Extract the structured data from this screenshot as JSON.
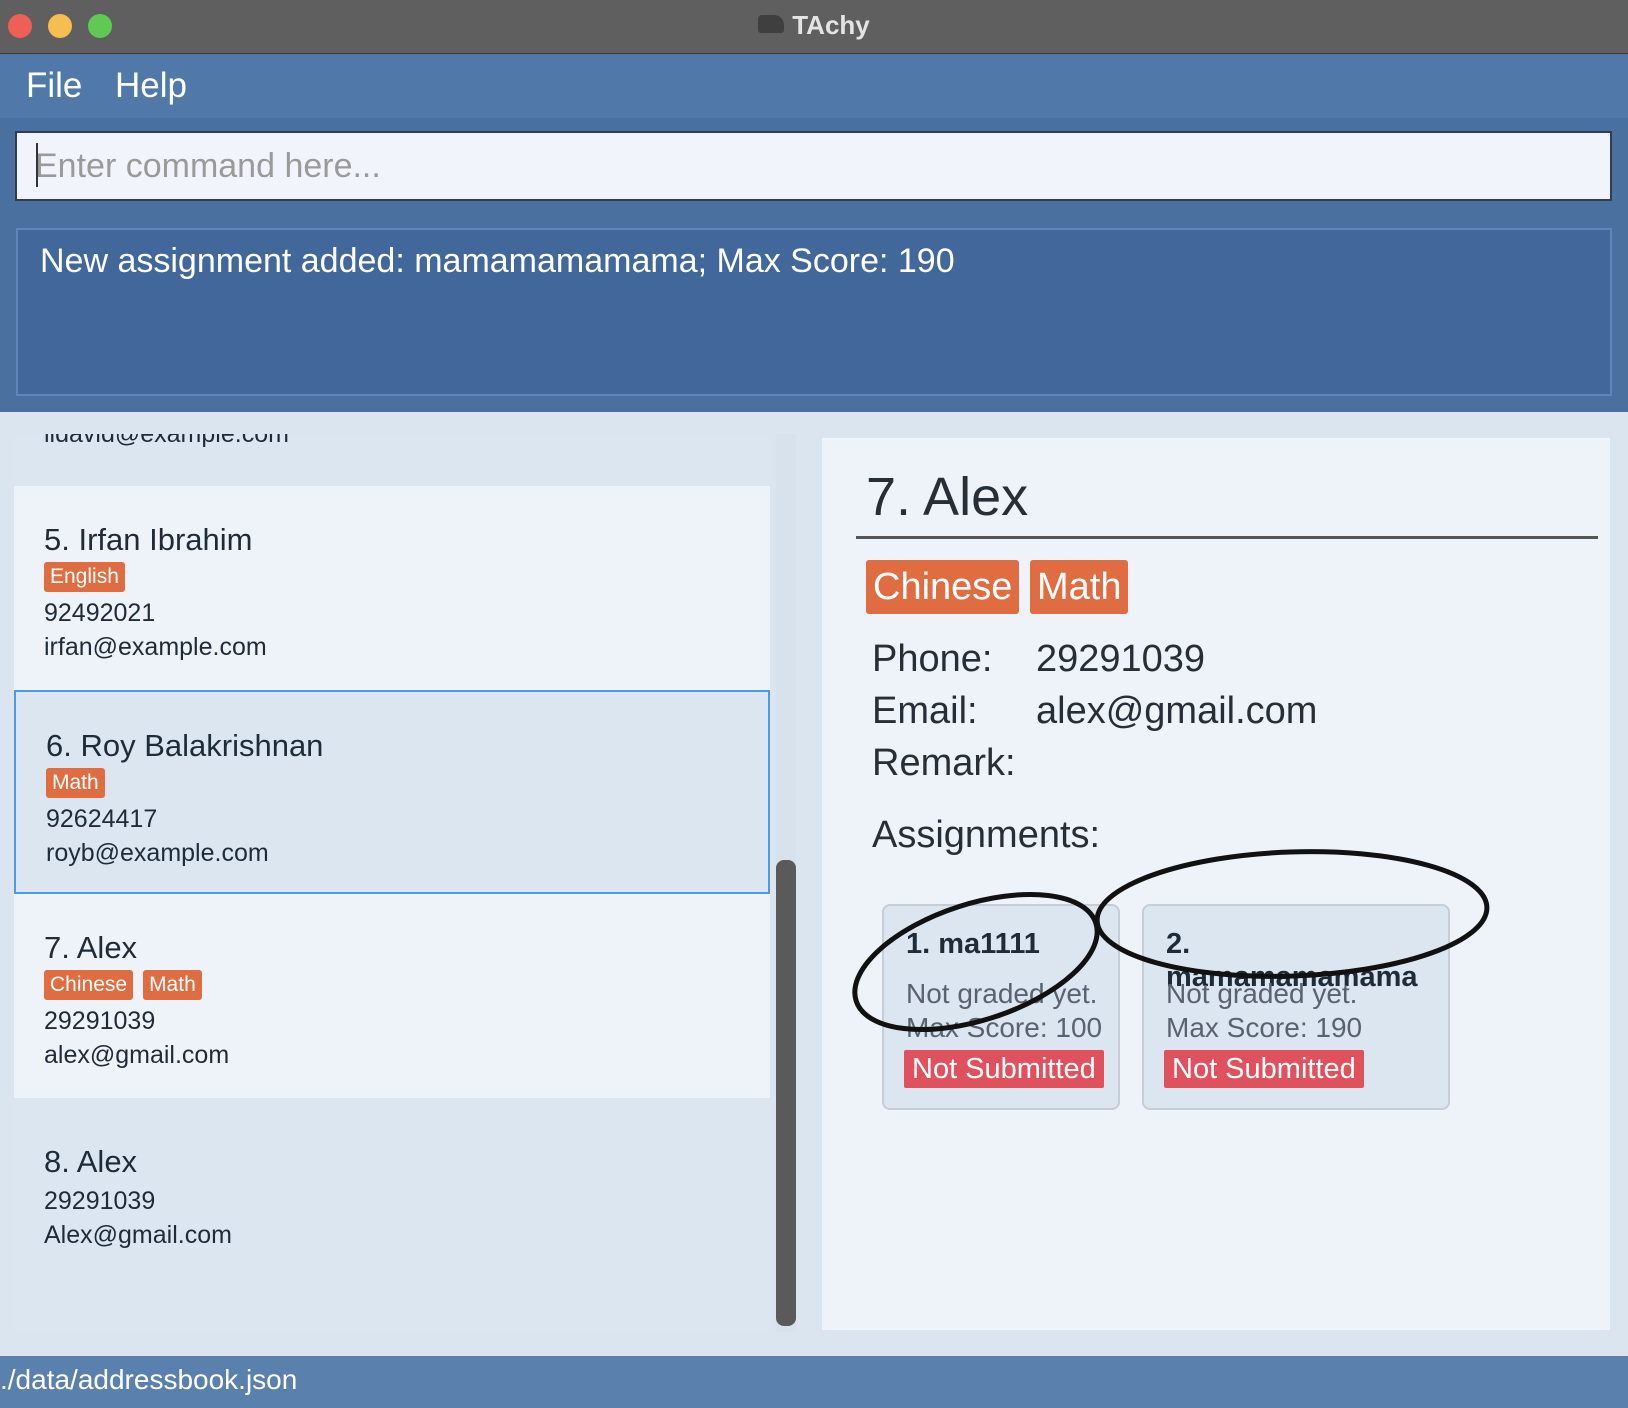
{
  "window": {
    "title": "TAchy",
    "icon": "app-icon"
  },
  "menu": {
    "file": "File",
    "help": "Help"
  },
  "command": {
    "placeholder": "Enter command here..."
  },
  "result": {
    "message": "New assignment added: mamamamamama; Max Score: 190"
  },
  "person_list": {
    "cards": [
      {
        "email": "lidavid@example.com"
      },
      {
        "name": "5. Irfan Ibrahim",
        "tags": [
          "English"
        ],
        "phone": "92492021",
        "email": "irfan@example.com"
      },
      {
        "name": "6. Roy Balakrishnan",
        "tags": [
          "Math"
        ],
        "phone": "92624417",
        "email": "royb@example.com",
        "selected": true
      },
      {
        "name": "7. Alex",
        "tags": [
          "Chinese",
          "Math"
        ],
        "phone": "29291039",
        "email": "alex@gmail.com"
      },
      {
        "name": "8. Alex",
        "tags": [],
        "phone": "29291039",
        "email": "Alex@gmail.com"
      }
    ]
  },
  "detail": {
    "name": "7. Alex",
    "tags": [
      "Chinese",
      "Math"
    ],
    "phone_label": "Phone:",
    "phone": "29291039",
    "email_label": "Email:",
    "email": "alex@gmail.com",
    "remark_label": "Remark:",
    "remark": "",
    "assignments_label": "Assignments:",
    "assignments": [
      {
        "title": "1. ma1111",
        "grade": "Not graded yet.",
        "max_score": "Max Score: 100",
        "status": "Not Submitted"
      },
      {
        "title": "2. mamamamamama",
        "grade": "Not graded yet.",
        "max_score": "Max Score: 190",
        "status": "Not Submitted"
      }
    ]
  },
  "status_bar": {
    "path": "./data/addressbook.json"
  },
  "colors": {
    "tag": "#e06c41",
    "not_submitted": "#e0515e",
    "selection_border": "#4a9be6",
    "menubar": "#5078a8"
  }
}
